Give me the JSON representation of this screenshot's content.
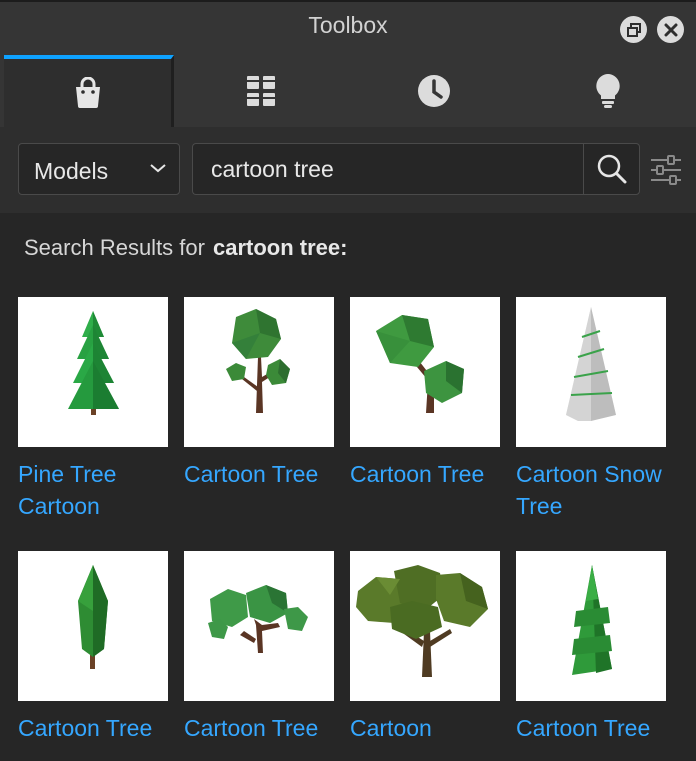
{
  "window": {
    "title": "Toolbox"
  },
  "tabs": [
    {
      "icon": "shopping-bag-icon",
      "active": true
    },
    {
      "icon": "inventory-grid-icon",
      "active": false
    },
    {
      "icon": "clock-icon",
      "active": false
    },
    {
      "icon": "lightbulb-icon",
      "active": false
    }
  ],
  "search": {
    "category": "Models",
    "query": "cartoon tree"
  },
  "results": {
    "label": "Search Results for",
    "term": "cartoon tree:",
    "items": [
      {
        "title": "Pine Tree Cartoon"
      },
      {
        "title": "Cartoon Tree"
      },
      {
        "title": "Cartoon Tree"
      },
      {
        "title": "Cartoon Snow Tree"
      },
      {
        "title": "Cartoon Tree"
      },
      {
        "title": "Cartoon Tree"
      },
      {
        "title": "Cartoon"
      },
      {
        "title": "Cartoon Tree"
      }
    ]
  },
  "colors": {
    "accent": "#0ea2ff",
    "link": "#35a7ff",
    "panel": "#2e2e2e",
    "content": "#262626"
  }
}
